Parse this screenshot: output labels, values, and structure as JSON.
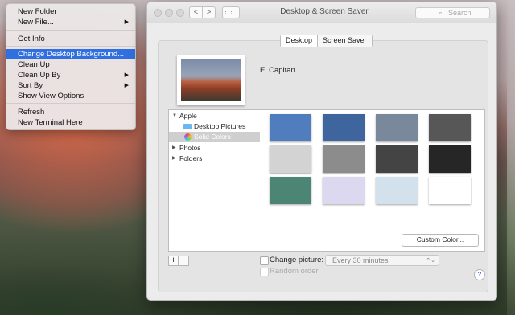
{
  "context_menu": {
    "items": [
      {
        "label": "New Folder",
        "submenu": false
      },
      {
        "label": "New File...",
        "submenu": true
      },
      {
        "label": "Get Info",
        "submenu": false
      },
      {
        "label": "Change Desktop Background...",
        "submenu": false,
        "highlighted": true
      },
      {
        "label": "Clean Up",
        "submenu": false
      },
      {
        "label": "Clean Up By",
        "submenu": true
      },
      {
        "label": "Sort By",
        "submenu": true
      },
      {
        "label": "Show View Options",
        "submenu": false
      },
      {
        "label": "Refresh",
        "submenu": false
      },
      {
        "label": "New Terminal Here",
        "submenu": false
      }
    ],
    "submenu_arrow": "▶"
  },
  "window": {
    "title": "Desktop & Screen Saver",
    "nav_back": "<",
    "nav_forward": ">",
    "grid_icon": "⋮⋮⋮",
    "search_placeholder": "Search",
    "search_icon": "⌕",
    "tabs": [
      "Desktop",
      "Screen Saver"
    ],
    "selected_tab": "Desktop",
    "preview_name": "El Capitan",
    "sidebar": {
      "items": [
        {
          "label": "Apple",
          "expanded": true
        },
        {
          "label": "Desktop Pictures"
        },
        {
          "label": "Solid Colors",
          "selected": true
        },
        {
          "label": "Photos",
          "expanded": false
        },
        {
          "label": "Folders",
          "expanded": false
        }
      ],
      "expanded_arrow": "▼",
      "collapsed_arrow": "▶"
    },
    "colors": [
      "#4f7dbe",
      "#3e659e",
      "#7a889b",
      "#575757",
      "#d3d3d3",
      "#8c8c8c",
      "#444444",
      "#262626",
      "#4d8575",
      "#dcd8f0",
      "#d3e1ec",
      "#ffffff"
    ],
    "custom_color_label": "Custom Color...",
    "add_label": "+",
    "remove_label": "−",
    "change_picture_label": "Change picture:",
    "interval_value": "Every 30 minutes",
    "interval_chevron": "⌃⌄",
    "random_order_label": "Random order",
    "help_label": "?"
  }
}
